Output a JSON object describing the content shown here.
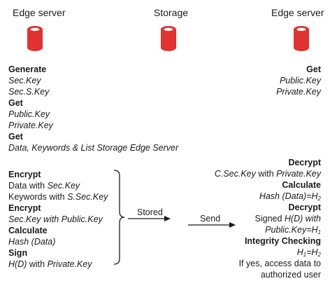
{
  "headers": {
    "left": "Edge server",
    "middle": "Storage",
    "right": "Edge server"
  },
  "icons": {
    "left": "database-icon",
    "middle": "database-icon",
    "right": "database-icon",
    "color": "#e0322f"
  },
  "left_top": {
    "generate_title": "Generate",
    "generate_items": [
      "Sec.Key",
      "Sec.S.Key"
    ],
    "get1_title": "Get",
    "get1_items": [
      "Public.Key",
      "Private.Key"
    ],
    "get2_title": "Get",
    "get2_item": "Data, Keywords & List Storage Edge Server"
  },
  "right_top": {
    "get_title": "Get",
    "items": [
      "Public.Key",
      "Private.Key"
    ]
  },
  "left_bottom": {
    "encrypt1_title": "Encrypt",
    "encrypt1_line1_a": "Data with ",
    "encrypt1_line1_b": "Sec.Key",
    "encrypt1_line2_a": "Keywords with ",
    "encrypt1_line2_b": "S.Sec.Key",
    "encrypt2_title": "Encrypt",
    "encrypt2_line": "Sec.Key with Public.Key",
    "calculate_title": "Calculate",
    "calculate_line": "Hash (Data)",
    "sign_title": "Sign",
    "sign_line_a": "H(D)",
    "sign_line_b": " with ",
    "sign_line_c": "Private.Key"
  },
  "arrows": {
    "stored": "Stored",
    "send": "Send"
  },
  "right_bottom": {
    "decrypt1_title": "Decrypt",
    "decrypt1_line_a": "C.Sec.Key",
    "decrypt1_line_b": " with ",
    "decrypt1_line_c": "Private.Key",
    "calculate_title": "Calculate",
    "calculate_line_a": "Hash (Data)=H",
    "calculate_line_sub": "2",
    "decrypt2_title": "Decrypt",
    "decrypt2_line1_a": "Signed ",
    "decrypt2_line1_b": "H(D) with",
    "decrypt2_line2_a": "Public.Key=H",
    "decrypt2_line2_sub": "1",
    "integrity_title": "Integrity Checking",
    "integrity_line_a": "H",
    "integrity_sub1": "1",
    "integrity_line_eq": "=H",
    "integrity_sub2": "2",
    "access_line1": "If yes, access data to",
    "access_line2": "authorized user"
  }
}
